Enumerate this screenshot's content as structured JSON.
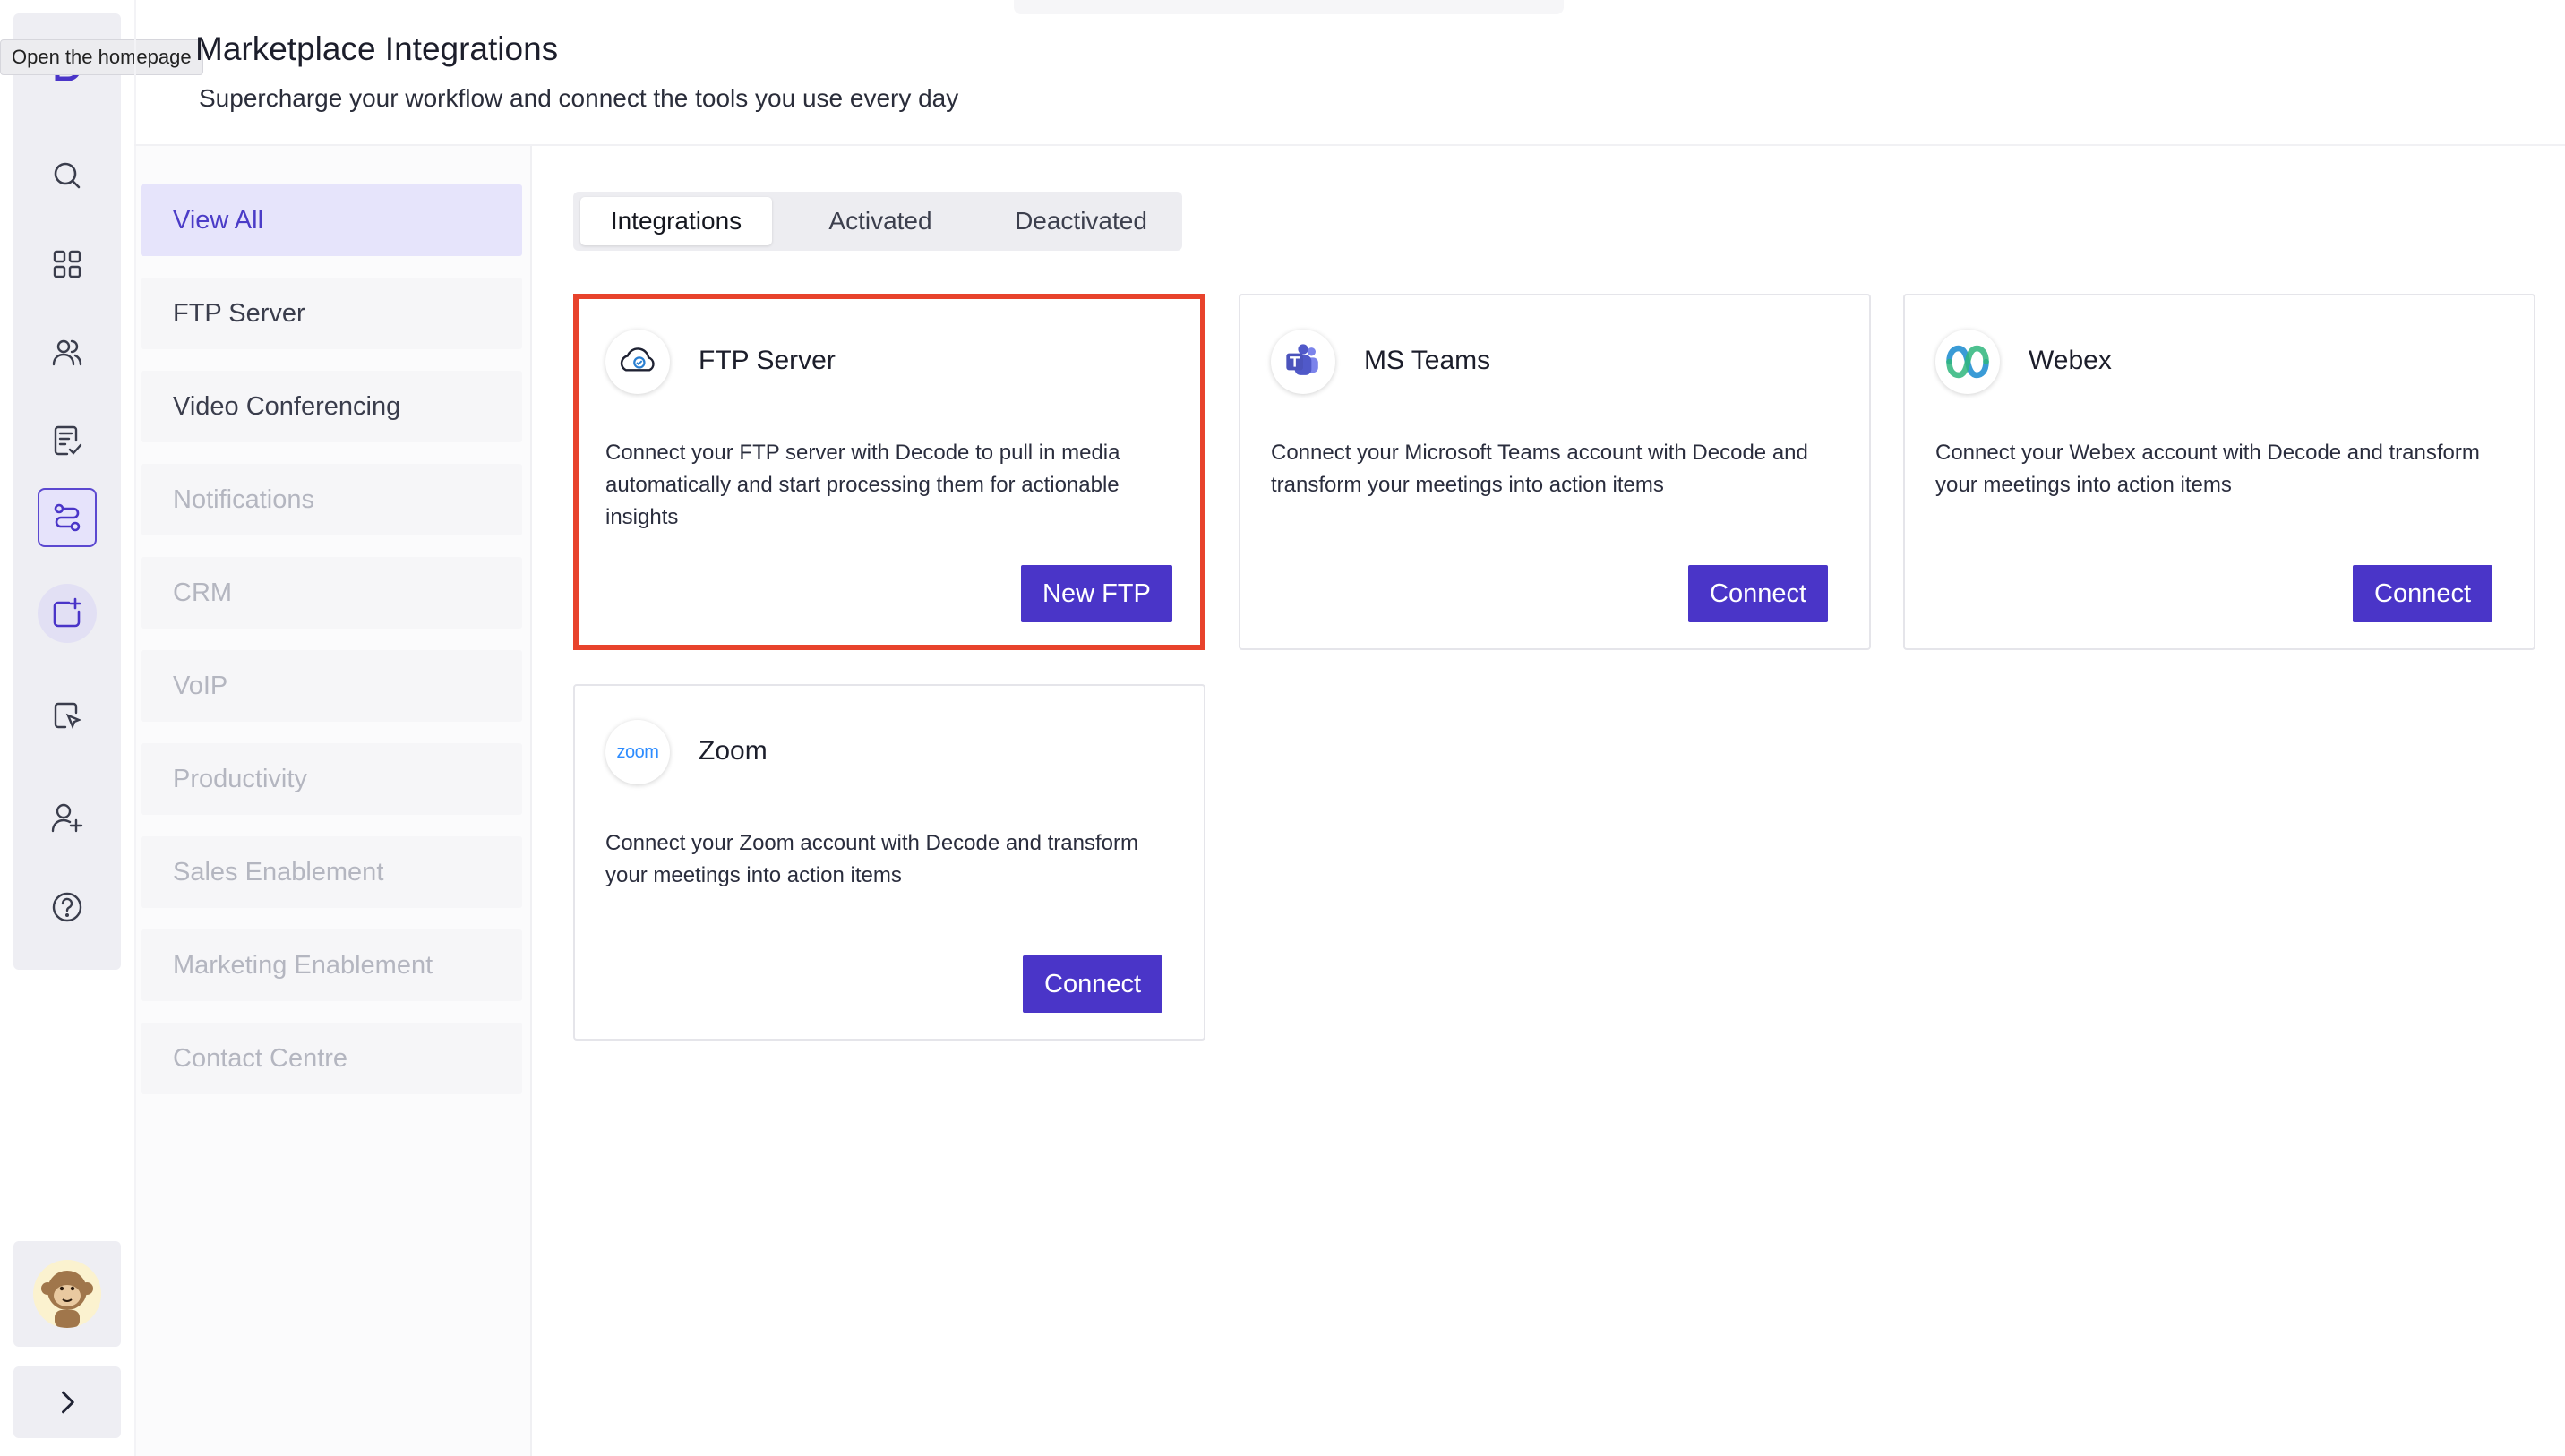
{
  "tooltip": "Open the homepage",
  "header": {
    "title": "Marketplace Integrations",
    "subtitle": "Supercharge your workflow and connect the tools you use every day"
  },
  "categories": [
    {
      "label": "View All",
      "state": "active"
    },
    {
      "label": "FTP Server",
      "state": "enabled"
    },
    {
      "label": "Video Conferencing",
      "state": "enabled"
    },
    {
      "label": "Notifications",
      "state": "disabled"
    },
    {
      "label": "CRM",
      "state": "disabled"
    },
    {
      "label": "VoIP",
      "state": "disabled"
    },
    {
      "label": "Productivity",
      "state": "disabled"
    },
    {
      "label": "Sales Enablement",
      "state": "disabled"
    },
    {
      "label": "Marketing Enablement",
      "state": "disabled"
    },
    {
      "label": "Contact Centre",
      "state": "disabled"
    }
  ],
  "tabs": [
    {
      "label": "Integrations",
      "selected": true
    },
    {
      "label": "Activated",
      "selected": false
    },
    {
      "label": "Deactivated",
      "selected": false
    }
  ],
  "cards": [
    {
      "title": "FTP Server",
      "description": "Connect your FTP server with Decode to pull in media automatically and start processing them for actionable insights",
      "button": "New FTP",
      "icon": "cloud-sync-icon",
      "highlighted": true
    },
    {
      "title": "MS Teams",
      "description": "Connect your Microsoft Teams account with Decode and transform your meetings into action items",
      "button": "Connect",
      "icon": "ms-teams-icon",
      "highlighted": false
    },
    {
      "title": "Webex",
      "description": "Connect your Webex account with Decode and transform your meetings into action items",
      "button": "Connect",
      "icon": "webex-icon",
      "highlighted": false
    },
    {
      "title": "Zoom",
      "description": "Connect your Zoom account with Decode and transform your meetings into action items",
      "button": "Connect",
      "icon": "zoom-icon",
      "logo_text": "zoom",
      "highlighted": false
    }
  ],
  "rail_icons": [
    "decode-logo-icon",
    "search-icon",
    "grid-icon",
    "users-icon",
    "report-icon",
    "integrations-icon",
    "add-media-icon",
    "cursor-icon",
    "add-user-icon",
    "help-icon"
  ],
  "colors": {
    "accent": "#4a35c8",
    "highlight_border": "#e8432c",
    "active_nav_bg": "#e6e4fb"
  }
}
